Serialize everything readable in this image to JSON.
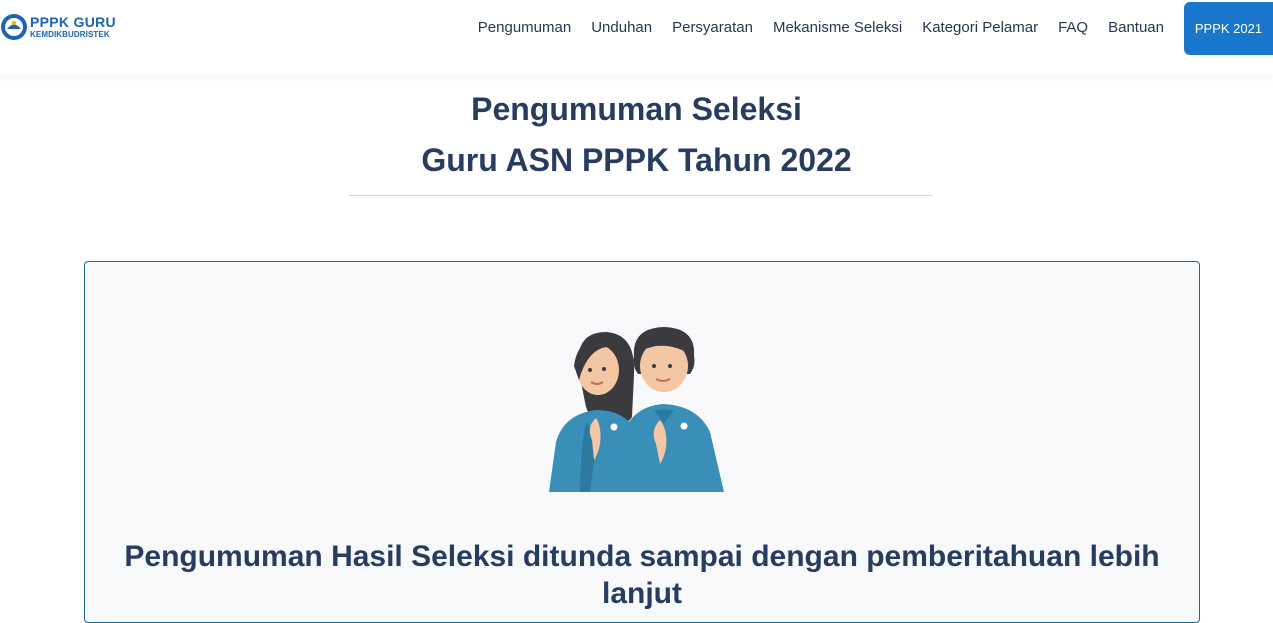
{
  "brand": {
    "title": "PPPK  GURU",
    "subtitle": "KEMDIKBUDRISTEK"
  },
  "nav": {
    "items": [
      "Pengumuman",
      "Unduhan",
      "Persyaratan",
      "Mekanisme Seleksi",
      "Kategori Pelamar",
      "FAQ",
      "Bantuan"
    ],
    "cta_label": "PPPK 2021"
  },
  "page": {
    "title_line1": "Pengumuman Seleksi",
    "title_line2": "Guru ASN PPPK Tahun 2022"
  },
  "card": {
    "illustration": "two-teachers-greeting-illustration",
    "message": "Pengumuman Hasil Seleksi ditunda sampai dengan pemberitahuan lebih lanjut"
  },
  "colors": {
    "accent": "#1877cc",
    "text": "#273c5e",
    "uniform": "#3a8fb8",
    "card_border": "#1b6a8a"
  }
}
